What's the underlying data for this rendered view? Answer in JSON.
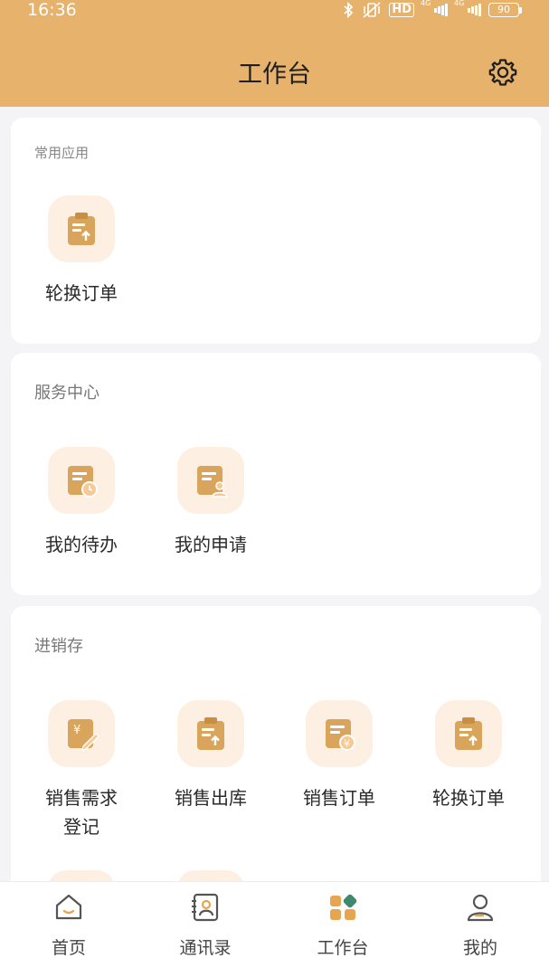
{
  "status_bar": {
    "time": "16:36",
    "network_1": "4G",
    "network_2": "4G",
    "hd": "HD",
    "battery": "90"
  },
  "header": {
    "title": "工作台",
    "settings_icon": "gear-icon"
  },
  "sections": [
    {
      "title": "常用应用",
      "items": [
        {
          "label": "轮换订单",
          "icon": "clipboard-upload-icon"
        }
      ]
    },
    {
      "title": "服务中心",
      "items": [
        {
          "label": "我的待办",
          "icon": "document-clock-icon"
        },
        {
          "label": "我的申请",
          "icon": "document-user-icon"
        }
      ]
    },
    {
      "title": "进销存",
      "items": [
        {
          "label_line1": "销售需求",
          "label_line2": "登记",
          "icon": "yen-edit-icon"
        },
        {
          "label": "销售出库",
          "icon": "clipboard-upload-icon"
        },
        {
          "label": "销售订单",
          "icon": "document-yen-icon"
        },
        {
          "label": "轮换订单",
          "icon": "clipboard-upload-icon"
        }
      ]
    }
  ],
  "tabbar": {
    "items": [
      {
        "label": "首页",
        "icon": "home-icon"
      },
      {
        "label": "通讯录",
        "icon": "contacts-icon"
      },
      {
        "label": "工作台",
        "icon": "workbench-icon",
        "active": true
      },
      {
        "label": "我的",
        "icon": "user-icon"
      }
    ]
  },
  "colors": {
    "header_bg": "#e6b26c",
    "icon_accent": "#d9a45b",
    "icon_bg": "#fdf0e3"
  }
}
